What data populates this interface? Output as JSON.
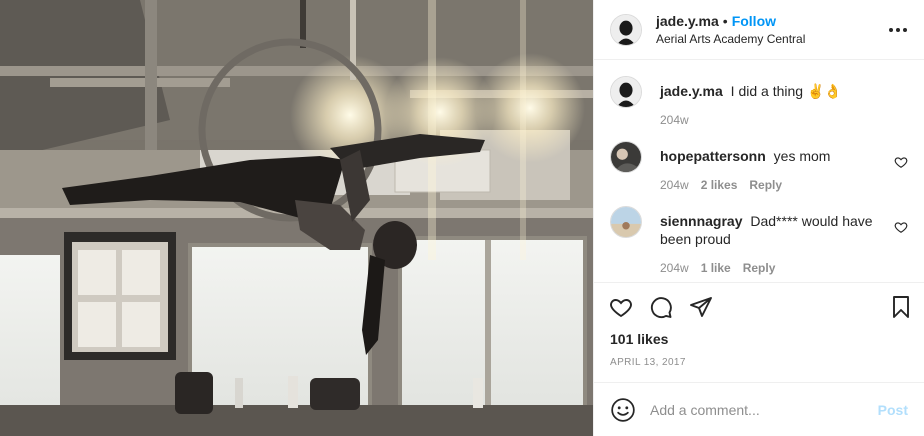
{
  "post": {
    "username": "jade.y.ma",
    "separator": "•",
    "follow_label": "Follow",
    "location": "Aerial Arts Academy Central",
    "caption_user": "jade.y.ma",
    "caption_text": "I did a thing ✌️👌",
    "caption_age": "204w",
    "likes": "101 likes",
    "date": "APRIL 13, 2017"
  },
  "comments": [
    {
      "username": "hopepattersonn",
      "text": "yes mom",
      "age": "204w",
      "likes": "2 likes",
      "reply": "Reply"
    },
    {
      "username": "siennnagray",
      "text": "Dad**** would have been proud",
      "age": "204w",
      "likes": "1 like",
      "reply": "Reply"
    }
  ],
  "composer": {
    "placeholder": "Add a comment...",
    "post_label": "Post"
  },
  "icons": {
    "more": "more-horizontal-icon",
    "heart": "heart-icon",
    "comment": "comment-icon",
    "share": "share-icon",
    "save": "bookmark-icon",
    "emoji": "emoji-icon"
  },
  "colors": {
    "accent": "#0095f6",
    "post_disabled": "#b2dffc",
    "muted": "#8e8e8e",
    "text": "#262626"
  }
}
